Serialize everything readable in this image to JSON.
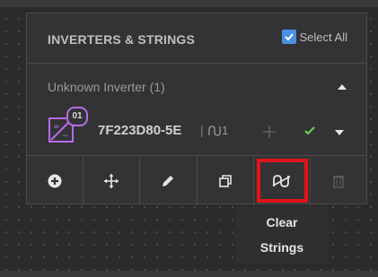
{
  "panel": {
    "title": "INVERTERS & STRINGS",
    "select_all_label": "Select All",
    "select_all_checked": true
  },
  "group": {
    "label": "Unknown Inverter (1)",
    "expanded": true
  },
  "inverter": {
    "badge_number": "01",
    "name": "7F223D80-5E",
    "separator": "|",
    "string_count": "1",
    "icons": [
      "inverter-icon",
      "strings-icon",
      "move-icon",
      "checkmark-icon",
      "chevron-down-icon"
    ]
  },
  "toolbar": {
    "tools": [
      "add-icon",
      "move-icon",
      "edit-icon",
      "duplicate-icon",
      "clear-strings-icon",
      "delete-icon"
    ],
    "active_tool": "clear-strings-icon"
  },
  "tooltip": {
    "line1": "Clear",
    "line2": "Strings"
  },
  "colors": {
    "accent": "#4a90e2",
    "badge": "#b56be8",
    "check": "#6bd64b",
    "highlight": "#e3131b"
  }
}
